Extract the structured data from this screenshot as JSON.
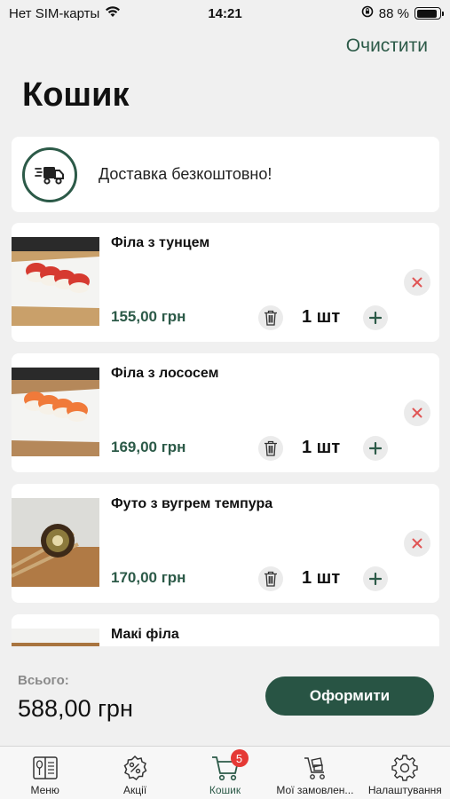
{
  "status_bar": {
    "carrier": "Нет SIM-карты",
    "time": "14:21",
    "battery": "88 %",
    "battery_level": 0.88
  },
  "header": {
    "clear_label": "Очистити",
    "title": "Кошик"
  },
  "delivery": {
    "text": "Доставка безкоштовно!",
    "icon": "delivery-truck-icon"
  },
  "items": [
    {
      "name": "Філа з тунцем",
      "price": "155,00 грн",
      "qty": "1 шт",
      "image": "sushi-tuna"
    },
    {
      "name": "Філа з лососем",
      "price": "169,00 грн",
      "qty": "1 шт",
      "image": "sushi-salmon"
    },
    {
      "name": "Футо з вугрем темпура",
      "price": "170,00 грн",
      "qty": "1 шт",
      "image": "sushi-eel-tempura"
    },
    {
      "name": "Макі філа",
      "price": "",
      "qty": "",
      "image": "sushi-maki"
    }
  ],
  "footer": {
    "total_label": "Всього:",
    "total_value": "588,00 грн",
    "checkout_label": "Оформити"
  },
  "tabs": [
    {
      "label": "Меню",
      "icon": "menu-book-icon"
    },
    {
      "label": "Акції",
      "icon": "discount-badge-icon"
    },
    {
      "label": "Кошик",
      "icon": "cart-icon",
      "badge": "5",
      "active": true
    },
    {
      "label": "Мої замовлен...",
      "icon": "orders-cart-icon"
    },
    {
      "label": "Налаштування",
      "icon": "settings-gear-icon"
    }
  ],
  "colors": {
    "accent": "#2c5a48",
    "checkout_button": "#285444",
    "badge": "#e53935",
    "remove_icon": "#e05555",
    "background": "#f0f0f0"
  }
}
